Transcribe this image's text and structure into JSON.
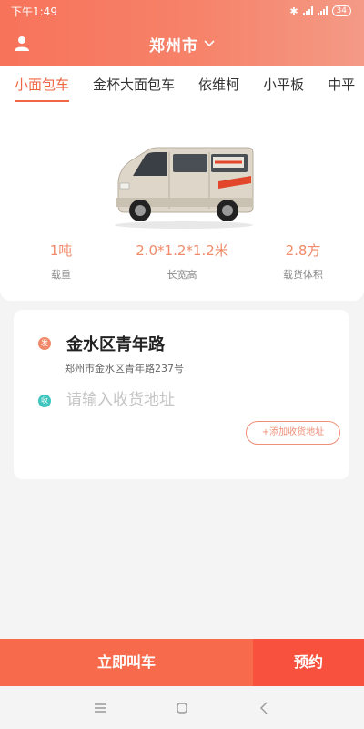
{
  "status_bar": {
    "time": "下午1:49",
    "battery": "34"
  },
  "header": {
    "city": "郑州市"
  },
  "tabs": [
    {
      "label": "小面包车",
      "active": true
    },
    {
      "label": "金杯大面包车",
      "active": false
    },
    {
      "label": "依维柯",
      "active": false
    },
    {
      "label": "小平板",
      "active": false
    },
    {
      "label": "中平",
      "active": false
    }
  ],
  "vehicle": {
    "specs": [
      {
        "value": "1吨",
        "label": "载重"
      },
      {
        "value": "2.0*1.2*1.2米",
        "label": "长宽高"
      },
      {
        "value": "2.8方",
        "label": "载货体积"
      }
    ]
  },
  "address": {
    "from_badge": "发",
    "from_title": "金水区青年路",
    "from_detail": "郑州市金水区青年路237号",
    "to_badge": "收",
    "to_placeholder": "请输入收货地址",
    "add_button": "+添加收货地址"
  },
  "actions": {
    "call_now": "立即叫车",
    "reserve": "预约"
  },
  "colors": {
    "accent": "#f06543",
    "header_start": "#f7735a",
    "header_end": "#f49a86",
    "receive_dot": "#3ec5be"
  }
}
